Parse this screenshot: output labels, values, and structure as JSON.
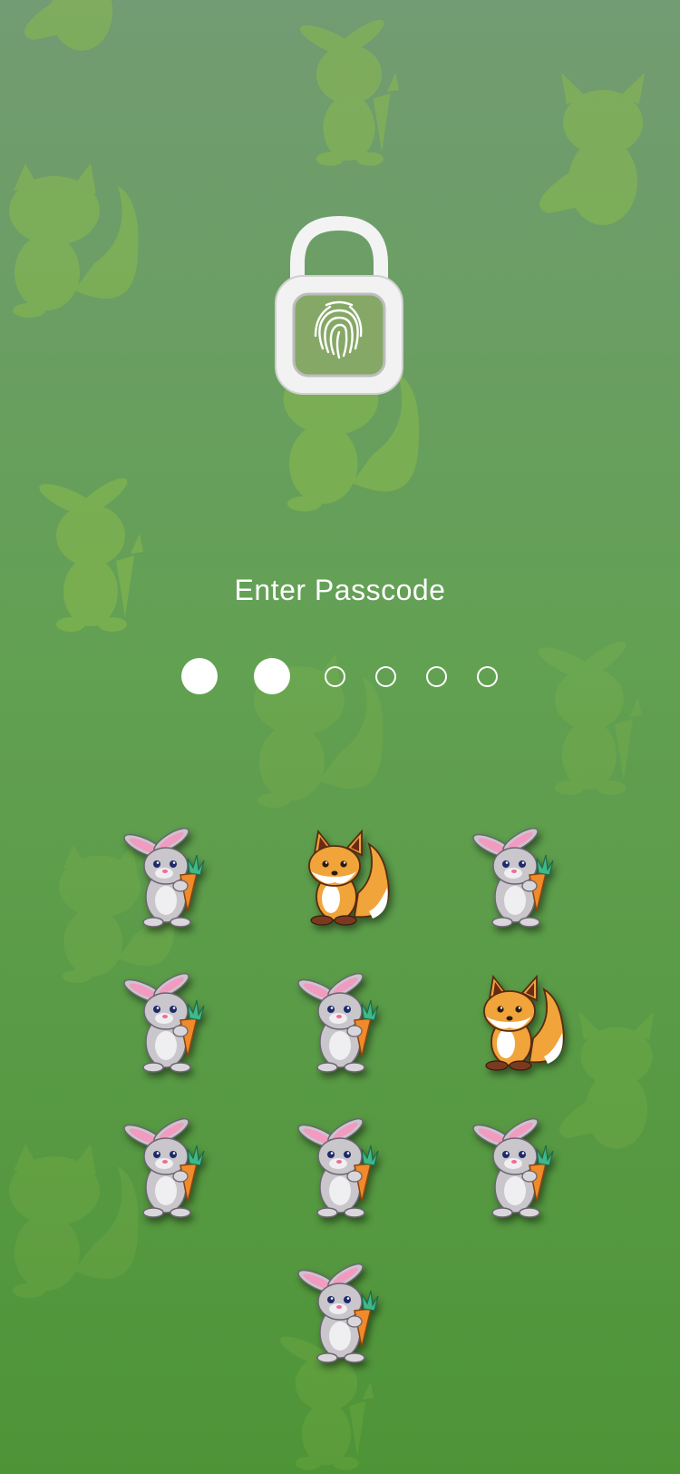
{
  "passcode": {
    "title": "Enter Passcode",
    "length": 6,
    "entered": 2
  },
  "keypad": {
    "keys": [
      {
        "animal": "bunny-icon"
      },
      {
        "animal": "fox-icon"
      },
      {
        "animal": "bunny-icon"
      },
      {
        "animal": "bunny-icon"
      },
      {
        "animal": "bunny-icon"
      },
      {
        "animal": "fox-icon"
      },
      {
        "animal": "bunny-icon"
      },
      {
        "animal": "bunny-icon"
      },
      {
        "animal": "bunny-icon"
      },
      {
        "animal": "bunny-icon"
      }
    ]
  },
  "icons": {
    "lock": "unlocked-padlock-icon",
    "fingerprint": "fingerprint-icon"
  },
  "colors": {
    "background_top": "#729c73",
    "background_bottom": "#4e9437",
    "pattern": "#8cbc4a",
    "text": "#ffffff"
  }
}
